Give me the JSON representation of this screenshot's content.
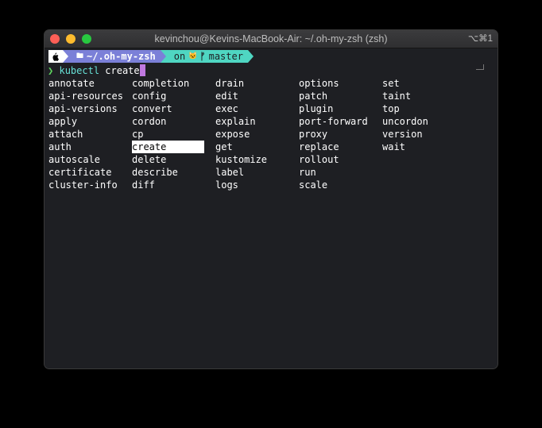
{
  "window": {
    "title": "kevinchou@Kevins-MacBook-Air: ~/.oh-my-zsh (zsh)",
    "shortcut": "⌥⌘1"
  },
  "prompt": {
    "apple_glyph": "",
    "dir_icon": "🖿",
    "dir": "~/.oh-my-zsh",
    "git_prefix": "on",
    "git_icon_cat": "🐱",
    "git_icon_branch": "ᚠ",
    "branch": "master"
  },
  "command": {
    "chevron": "❯",
    "program": "kubectl",
    "arg": "create"
  },
  "completions": [
    {
      "label": "annotate",
      "selected": false
    },
    {
      "label": "api-resources",
      "selected": false
    },
    {
      "label": "api-versions",
      "selected": false
    },
    {
      "label": "apply",
      "selected": false
    },
    {
      "label": "attach",
      "selected": false
    },
    {
      "label": "auth",
      "selected": false
    },
    {
      "label": "autoscale",
      "selected": false
    },
    {
      "label": "certificate",
      "selected": false
    },
    {
      "label": "cluster-info",
      "selected": false
    },
    {
      "label": "completion",
      "selected": false
    },
    {
      "label": "config",
      "selected": false
    },
    {
      "label": "convert",
      "selected": false
    },
    {
      "label": "cordon",
      "selected": false
    },
    {
      "label": "cp",
      "selected": false
    },
    {
      "label": "create",
      "selected": true
    },
    {
      "label": "delete",
      "selected": false
    },
    {
      "label": "describe",
      "selected": false
    },
    {
      "label": "diff",
      "selected": false
    },
    {
      "label": "drain",
      "selected": false
    },
    {
      "label": "edit",
      "selected": false
    },
    {
      "label": "exec",
      "selected": false
    },
    {
      "label": "explain",
      "selected": false
    },
    {
      "label": "expose",
      "selected": false
    },
    {
      "label": "get",
      "selected": false
    },
    {
      "label": "kustomize",
      "selected": false
    },
    {
      "label": "label",
      "selected": false
    },
    {
      "label": "logs",
      "selected": false
    },
    {
      "label": "options",
      "selected": false
    },
    {
      "label": "patch",
      "selected": false
    },
    {
      "label": "plugin",
      "selected": false
    },
    {
      "label": "port-forward",
      "selected": false
    },
    {
      "label": "proxy",
      "selected": false
    },
    {
      "label": "replace",
      "selected": false
    },
    {
      "label": "rollout",
      "selected": false
    },
    {
      "label": "run",
      "selected": false
    },
    {
      "label": "scale",
      "selected": false
    },
    {
      "label": "set",
      "selected": false
    },
    {
      "label": "taint",
      "selected": false
    },
    {
      "label": "top",
      "selected": false
    },
    {
      "label": "uncordon",
      "selected": false
    },
    {
      "label": "version",
      "selected": false
    },
    {
      "label": "wait",
      "selected": false
    }
  ],
  "colors": {
    "terminal_bg": "#1e1f23",
    "segment_dir": "#7b80d8",
    "segment_git": "#4fd6c2",
    "cursor": "#c078e0",
    "chevron": "#5fd75f",
    "program": "#67e0d6"
  }
}
